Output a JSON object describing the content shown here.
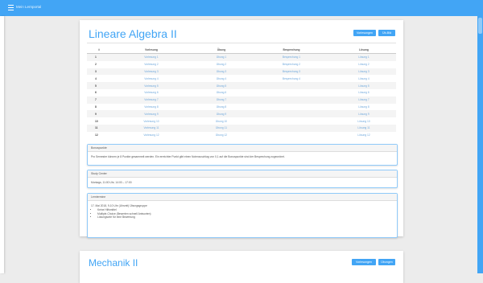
{
  "app": {
    "title": "Mein Lernportal"
  },
  "courses": [
    {
      "title": "Lineare Algebra II",
      "buttons": [
        "Vorlesungen",
        "Üb-Blä"
      ],
      "table": {
        "headers": [
          "#",
          "Vorlesung",
          "Übung",
          "Besprechung",
          "Lösung"
        ],
        "rows": [
          [
            "1",
            "Vorlesung 1",
            "Übung 1",
            "Besprechung 1",
            "Lösung 1"
          ],
          [
            "2",
            "Vorlesung 2",
            "Übung 2",
            "Besprechung 2",
            "Lösung 2"
          ],
          [
            "3",
            "Vorlesung 3",
            "Übung 3",
            "Besprechung 3",
            "Lösung 3"
          ],
          [
            "4",
            "Vorlesung 4",
            "Übung 4",
            "Besprechung 4",
            "Lösung 4"
          ],
          [
            "5",
            "Vorlesung 5",
            "Übung 5",
            "",
            "Lösung 5"
          ],
          [
            "6",
            "Vorlesung 6",
            "Übung 6",
            "",
            "Lösung 6"
          ],
          [
            "7",
            "Vorlesung 7",
            "Übung 7",
            "",
            "Lösung 7"
          ],
          [
            "8",
            "Vorlesung 8",
            "Übung 8",
            "",
            "Lösung 8"
          ],
          [
            "9",
            "Vorlesung 9",
            "Übung 9",
            "",
            "Lösung 9"
          ],
          [
            "10",
            "Vorlesung 10",
            "Übung 10",
            "",
            "Lösung 10"
          ],
          [
            "11",
            "Vorlesung 11",
            "Übung 11",
            "",
            "Lösung 11"
          ],
          [
            "12",
            "Vorlesung 12",
            "Übung 12",
            "",
            "Lösung 12"
          ]
        ]
      },
      "panels": [
        {
          "title": "Bonuspunkte",
          "body": "Pro Semester können je 8 Punkte gesammelt werden. Ein erreichter Punkt gibt einen Notenzuschlag von 0,1 auf die Bonuspunkte sind der Besprechung zugeordnet."
        },
        {
          "title": "Study Center",
          "body": "Montags, 11:00 Uhr, 14:00 – 17:00"
        },
        {
          "title": "Lerntermine",
          "body": "17. Mai 2018, 9-10 Uhr (Uhrzeit) Übungsgruppe",
          "items": [
            "Keine Hilfsmittel",
            "Multiple-Choice (Bewerten schnell Antworten)",
            "Lösungsorte für eine Bewertung"
          ]
        }
      ]
    },
    {
      "title": "Mechanik II",
      "buttons": [
        "Vorlesungen",
        "Übungen"
      ]
    }
  ],
  "colors": {
    "accent": "#42a5f5",
    "link": "#6fa8dc"
  },
  "icons": {
    "menu": "hamburger-menu-icon"
  }
}
